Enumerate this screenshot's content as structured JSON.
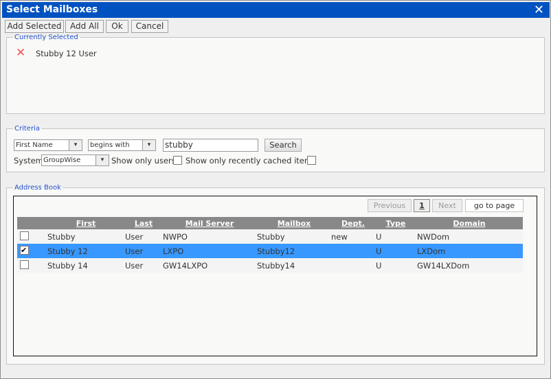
{
  "window": {
    "title": "Select Mailboxes",
    "close_icon": "close-icon"
  },
  "toolbar": {
    "add_selected": "Add Selected",
    "add_all": "Add All",
    "ok": "Ok",
    "cancel": "Cancel"
  },
  "currently_selected": {
    "legend": "Currently Selected",
    "items": [
      {
        "name": "Stubby 12 User",
        "icon": "remove-x-icon"
      }
    ]
  },
  "criteria": {
    "legend": "Criteria",
    "field": "First Name",
    "operator": "begins with",
    "value": "stubby",
    "search": "Search",
    "system_label": "System",
    "system": "GroupWise",
    "show_only_users": "Show only users",
    "show_only_users_checked": false,
    "show_cached": "Show only recently cached items",
    "show_cached_checked": false
  },
  "address_book": {
    "legend": "Address Book",
    "pager": {
      "previous": "Previous",
      "page": "1",
      "next": "Next",
      "goto": "go to page"
    },
    "columns": [
      "First",
      "Last",
      "Mail Server",
      "Mailbox",
      "Dept.",
      "Type",
      "Domain"
    ],
    "rows": [
      {
        "checked": false,
        "cells": [
          "Stubby",
          "User",
          "NWPO",
          "Stubby",
          "new",
          "U",
          "NWDom"
        ]
      },
      {
        "checked": true,
        "selected": true,
        "cells": [
          "Stubby 12",
          "User",
          "LXPO",
          "Stubby12",
          "",
          "U",
          "LXDom"
        ]
      },
      {
        "checked": false,
        "cells": [
          "Stubby 14",
          "User",
          "GW14LXPO",
          "Stubby14",
          "",
          "U",
          "GW14LXDom"
        ]
      }
    ]
  },
  "colors": {
    "title_bar": "#0152c1",
    "selected_row": "#3898ff",
    "header": "#888888"
  }
}
